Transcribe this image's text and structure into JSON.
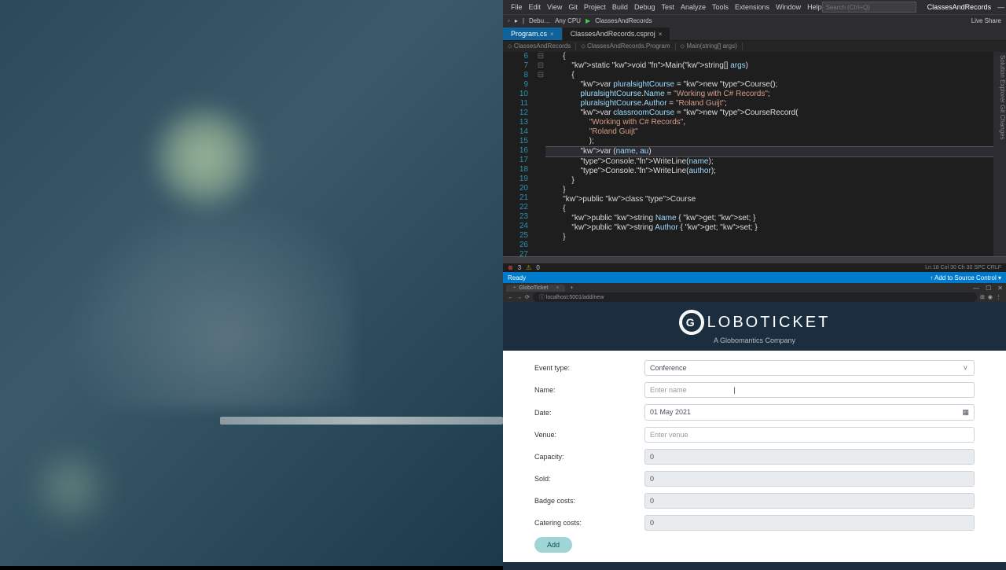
{
  "vs": {
    "menu": [
      "File",
      "Edit",
      "View",
      "Git",
      "Project",
      "Build",
      "Debug",
      "Test",
      "Analyze",
      "Tools",
      "Extensions",
      "Window",
      "Help"
    ],
    "search_placeholder": "Search (Ctrl+Q)",
    "project_name": "ClassesAndRecords",
    "live_share": "Live Share",
    "toolbar": {
      "config": "Debu…",
      "platform": "Any CPU",
      "run": "ClassesAndRecords"
    },
    "tabs": [
      {
        "label": "Program.cs",
        "active": true
      },
      {
        "label": "ClassesAndRecords.csproj",
        "active": false
      }
    ],
    "breadcrumb": [
      "ClassesAndRecords",
      "ClassesAndRecords.Program",
      "Main(string[] args)"
    ],
    "side_tabs": [
      "Solution Explorer",
      "Git Changes"
    ],
    "errorbar": {
      "errors": "3",
      "warnings": "0"
    },
    "status": {
      "left": "Ready",
      "right": "↑ Add to Source Control ▾"
    },
    "code": {
      "start": 6,
      "lines": [
        "        {",
        "            static void Main(string[] args)",
        "            {",
        "                var pluralsightCourse = new Course();",
        "                pluralsightCourse.Name = \"Working with C# Records\";",
        "                pluralsightCourse.Author = \"Roland Guijt\";",
        "",
        "                var classroomCourse = new CourseRecord(",
        "                    \"Working with C# Records\",",
        "                    \"Roland Guijt\"",
        "                    );",
        "",
        "                var (name, au)",
        "                Console.WriteLine(name);",
        "                Console.WriteLine(author);",
        "            }",
        "        }",
        "",
        "        public class Course",
        "        {",
        "            public string Name { get; set; }",
        "            public string Author { get; set; }",
        "        }",
        ""
      ]
    }
  },
  "browser": {
    "tab_title": "GloboTicket",
    "url": "localhost:5001/add/new",
    "logo_text": "LOBOTICKET",
    "tagline": "A Globomantics Company",
    "form": {
      "event_type": {
        "label": "Event type:",
        "value": "Conference"
      },
      "name": {
        "label": "Name:",
        "placeholder": "Enter name"
      },
      "date": {
        "label": "Date:",
        "value": "01 May 2021"
      },
      "venue": {
        "label": "Venue:",
        "placeholder": "Enter venue"
      },
      "capacity": {
        "label": "Capacity:",
        "value": "0"
      },
      "sold": {
        "label": "Sold:",
        "value": "0"
      },
      "badge_costs": {
        "label": "Badge costs:",
        "value": "0"
      },
      "catering_costs": {
        "label": "Catering costs:",
        "value": "0"
      },
      "add_button": "Add"
    }
  }
}
